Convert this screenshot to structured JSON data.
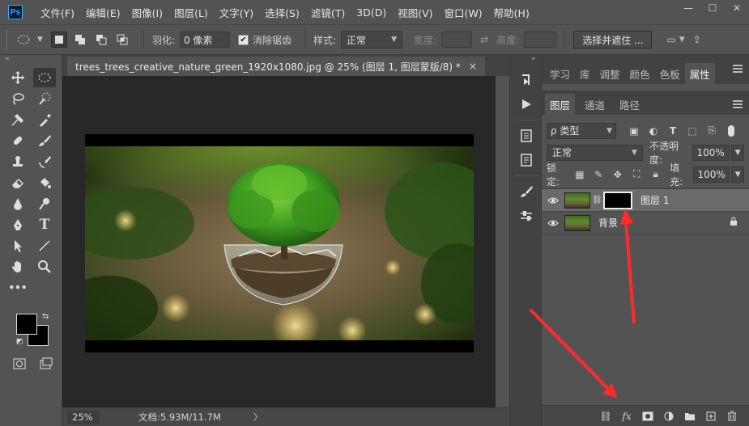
{
  "app": {
    "logo": "Ps",
    "menu": [
      "文件(F)",
      "编辑(E)",
      "图像(I)",
      "图层(L)",
      "文字(Y)",
      "选择(S)",
      "滤镜(T)",
      "3D(D)",
      "视图(V)",
      "窗口(W)",
      "帮助(H)"
    ],
    "window_controls": [
      "minimize-icon",
      "maximize-icon",
      "close-icon"
    ]
  },
  "options": {
    "feather_label": "羽化:",
    "feather_value": "0 像素",
    "antialias_label": "消除锯齿",
    "antialias_checked": true,
    "style_label": "样式:",
    "style_value": "正常",
    "width_label": "宽度:",
    "height_label": "高度:",
    "select_mask_button": "选择并遮住 ..."
  },
  "document": {
    "tab_title": "trees_trees_creative_nature_green_1920x1080.jpg @ 25% (图层 1, 图层蒙版/8) *",
    "close": "×"
  },
  "status": {
    "zoom": "25%",
    "doc_size": "文档:5.93M/11.7M",
    "arrow": "〉"
  },
  "panels": {
    "top_tabs": [
      "学习",
      "库",
      "调整",
      "颜色",
      "色板",
      "属性"
    ],
    "top_active": "属性",
    "layer_tabs": [
      "图层",
      "通道",
      "路径"
    ],
    "layer_active": "图层",
    "filter_label": "ρ 类型",
    "blend_mode": "正常",
    "opacity_label": "不透明度:",
    "opacity_value": "100%",
    "lock_label": "锁定:",
    "fill_label": "填充:",
    "fill_value": "100%",
    "layers": [
      {
        "name": "图层 1",
        "has_mask": true,
        "selected": true,
        "locked": false
      },
      {
        "name": "背景",
        "has_mask": false,
        "selected": false,
        "locked": true
      }
    ],
    "footer_icons": [
      "link-icon",
      "fx-icon",
      "add-mask-icon",
      "adjustment-icon",
      "folder-icon",
      "new-layer-icon",
      "trash-icon"
    ]
  },
  "colors": {
    "ui_bg": "#535353",
    "canvas_bg": "#282828",
    "accent": "#31a8ff",
    "annotation_arrow": "#ff2a2a"
  }
}
